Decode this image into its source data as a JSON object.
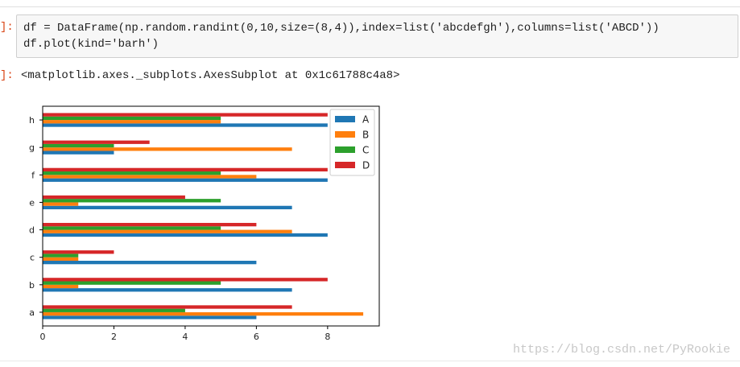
{
  "cell": {
    "in_prompt": "]:",
    "out_prompt": "]:",
    "code_line_1": "df = DataFrame(np.random.randint(0,10,size=(8,4)),index=list('abcdefgh'),columns=list('ABCD'))",
    "code_line_2": "df.plot(kind='barh')",
    "output": "<matplotlib.axes._subplots.AxesSubplot at 0x1c61788c4a8>"
  },
  "watermark": "https://blog.csdn.net/PyRookie",
  "chart_data": {
    "type": "bar",
    "orientation": "horizontal",
    "title": "",
    "xlabel": "",
    "ylabel": "",
    "xlim": [
      0,
      9.45
    ],
    "xticks": [
      0,
      2,
      4,
      6,
      8
    ],
    "categories": [
      "a",
      "b",
      "c",
      "d",
      "e",
      "f",
      "g",
      "h"
    ],
    "series": [
      {
        "name": "A",
        "color": "#1f77b4",
        "values": [
          6,
          7,
          6,
          8,
          7,
          8,
          2,
          8
        ]
      },
      {
        "name": "B",
        "color": "#ff7f0e",
        "values": [
          9,
          1,
          1,
          7,
          1,
          6,
          7,
          5
        ]
      },
      {
        "name": "C",
        "color": "#2ca02c",
        "values": [
          4,
          5,
          1,
          5,
          5,
          5,
          2,
          5
        ]
      },
      {
        "name": "D",
        "color": "#d62728",
        "values": [
          7,
          8,
          2,
          6,
          4,
          8,
          3,
          8
        ]
      }
    ],
    "legend_position": "top-right",
    "grid": false
  }
}
